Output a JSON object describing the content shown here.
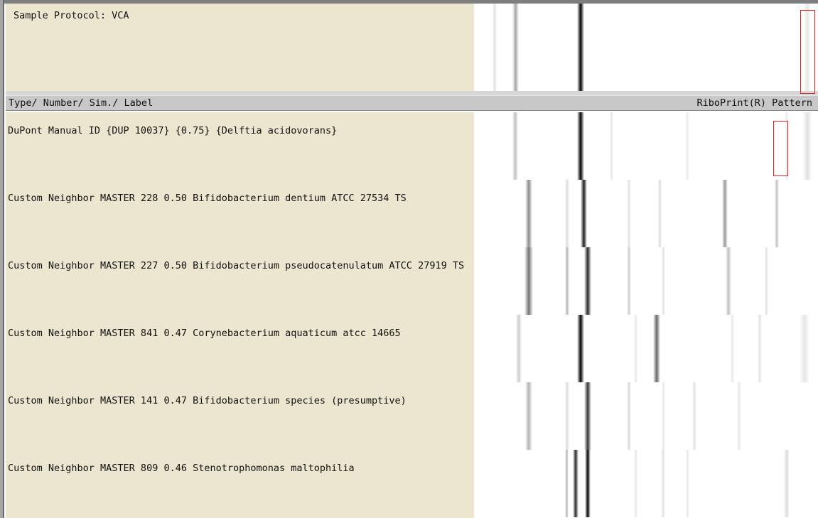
{
  "sample": {
    "protocol_text": "Sample Protocol: VCA",
    "bands": [
      {
        "pos": 0.06,
        "w": 6,
        "shade": 0.12
      },
      {
        "pos": 0.12,
        "w": 9,
        "shade": 0.35
      },
      {
        "pos": 0.31,
        "w": 10,
        "shade": 1.0
      },
      {
        "pos": 0.97,
        "w": 10,
        "shade": 0.1
      }
    ]
  },
  "header": {
    "left_label": "Type/ Number/ Sim./ Label",
    "right_label": "RiboPrint(R) Pattern"
  },
  "results": [
    {
      "text": "DuPont Manual ID {DUP 10037} {0.75} {Delftia acidovorans}",
      "bands": [
        {
          "pos": 0.12,
          "w": 8,
          "shade": 0.25
        },
        {
          "pos": 0.31,
          "w": 10,
          "shade": 1.0
        },
        {
          "pos": 0.4,
          "w": 5,
          "shade": 0.1
        },
        {
          "pos": 0.62,
          "w": 6,
          "shade": 0.08
        },
        {
          "pos": 0.91,
          "w": 6,
          "shade": 0.08
        },
        {
          "pos": 0.97,
          "w": 12,
          "shade": 0.12
        }
      ]
    },
    {
      "text": "Custom Neighbor MASTER 228 0.50 Bifidobacterium dentium ATCC 27534 TS",
      "bands": [
        {
          "pos": 0.16,
          "w": 10,
          "shade": 0.45
        },
        {
          "pos": 0.27,
          "w": 6,
          "shade": 0.15
        },
        {
          "pos": 0.32,
          "w": 9,
          "shade": 0.9
        },
        {
          "pos": 0.45,
          "w": 6,
          "shade": 0.12
        },
        {
          "pos": 0.54,
          "w": 5,
          "shade": 0.15
        },
        {
          "pos": 0.73,
          "w": 8,
          "shade": 0.4
        },
        {
          "pos": 0.88,
          "w": 6,
          "shade": 0.25
        }
      ]
    },
    {
      "text": "Custom Neighbor MASTER 227 0.50 Bifidobacterium pseudocatenulatum ATCC 27919 TS",
      "bands": [
        {
          "pos": 0.16,
          "w": 12,
          "shade": 0.55
        },
        {
          "pos": 0.27,
          "w": 6,
          "shade": 0.3
        },
        {
          "pos": 0.33,
          "w": 10,
          "shade": 0.85
        },
        {
          "pos": 0.45,
          "w": 6,
          "shade": 0.2
        },
        {
          "pos": 0.55,
          "w": 5,
          "shade": 0.12
        },
        {
          "pos": 0.74,
          "w": 8,
          "shade": 0.25
        },
        {
          "pos": 0.85,
          "w": 5,
          "shade": 0.12
        }
      ]
    },
    {
      "text": "Custom Neighbor MASTER 841 0.47 Corynebacterium aquaticum atcc 14665",
      "bands": [
        {
          "pos": 0.13,
          "w": 8,
          "shade": 0.2
        },
        {
          "pos": 0.31,
          "w": 10,
          "shade": 1.0
        },
        {
          "pos": 0.47,
          "w": 5,
          "shade": 0.1
        },
        {
          "pos": 0.53,
          "w": 10,
          "shade": 0.6
        },
        {
          "pos": 0.75,
          "w": 5,
          "shade": 0.1
        },
        {
          "pos": 0.83,
          "w": 6,
          "shade": 0.12
        },
        {
          "pos": 0.96,
          "w": 14,
          "shade": 0.1
        }
      ]
    },
    {
      "text": "Custom Neighbor MASTER 141 0.47 Bifidobacterium species (presumptive)",
      "bands": [
        {
          "pos": 0.16,
          "w": 10,
          "shade": 0.3
        },
        {
          "pos": 0.27,
          "w": 6,
          "shade": 0.15
        },
        {
          "pos": 0.33,
          "w": 10,
          "shade": 0.8
        },
        {
          "pos": 0.45,
          "w": 6,
          "shade": 0.15
        },
        {
          "pos": 0.55,
          "w": 5,
          "shade": 0.1
        },
        {
          "pos": 0.64,
          "w": 6,
          "shade": 0.12
        },
        {
          "pos": 0.77,
          "w": 6,
          "shade": 0.1
        }
      ]
    },
    {
      "text": "Custom Neighbor MASTER 809 0.46 Stenotrophomonas maltophilia",
      "bands": [
        {
          "pos": 0.27,
          "w": 5,
          "shade": 0.3
        },
        {
          "pos": 0.295,
          "w": 8,
          "shade": 0.85
        },
        {
          "pos": 0.33,
          "w": 8,
          "shade": 1.0
        },
        {
          "pos": 0.47,
          "w": 5,
          "shade": 0.1
        },
        {
          "pos": 0.55,
          "w": 6,
          "shade": 0.12
        },
        {
          "pos": 0.62,
          "w": 5,
          "shade": 0.1
        },
        {
          "pos": 0.91,
          "w": 8,
          "shade": 0.15
        }
      ]
    }
  ],
  "colors": {
    "label_bg": "#ece6d0",
    "header_bg": "#c8c8c8",
    "highlight": "#e02020"
  }
}
